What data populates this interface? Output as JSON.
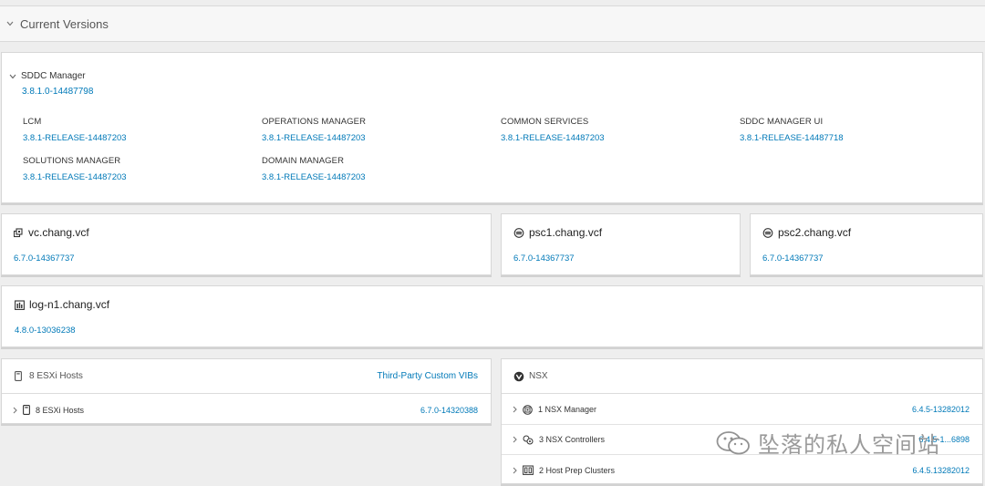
{
  "section": {
    "title": "Current Versions"
  },
  "sddc": {
    "title": "SDDC Manager",
    "version": "3.8.1.0-14487798",
    "components": [
      {
        "name": "LCM",
        "version": "3.8.1-RELEASE-14487203"
      },
      {
        "name": "OPERATIONS MANAGER",
        "version": "3.8.1-RELEASE-14487203"
      },
      {
        "name": "COMMON SERVICES",
        "version": "3.8.1-RELEASE-14487203"
      },
      {
        "name": "SDDC MANAGER UI",
        "version": "3.8.1-RELEASE-14487718"
      },
      {
        "name": "SOLUTIONS MANAGER",
        "version": "3.8.1-RELEASE-14487203"
      },
      {
        "name": "DOMAIN MANAGER",
        "version": "3.8.1-RELEASE-14487203"
      }
    ]
  },
  "vms": [
    {
      "name": "vc.chang.vcf",
      "version": "6.7.0-14367737",
      "icon": "vcenter-icon"
    },
    {
      "name": "psc1.chang.vcf",
      "version": "6.7.0-14367737",
      "icon": "psc-icon"
    },
    {
      "name": "psc2.chang.vcf",
      "version": "6.7.0-14367737",
      "icon": "psc-icon"
    },
    {
      "name": "log-n1.chang.vcf",
      "version": "4.8.0-13036238",
      "icon": "log-insight-icon"
    }
  ],
  "esxi_panel": {
    "title": "8 ESXi Hosts",
    "link": "Third-Party Custom VIBs",
    "rows": [
      {
        "label": "8 ESXi Hosts",
        "version": "6.7.0-14320388"
      }
    ]
  },
  "nsx_panel": {
    "title": "NSX",
    "rows": [
      {
        "label": "1 NSX Manager",
        "version": "6.4.5-13282012"
      },
      {
        "label": "3 NSX Controllers",
        "version": "6.4.5-1...6898"
      },
      {
        "label": "2 Host Prep Clusters",
        "version": "6.4.5.13282012"
      }
    ]
  },
  "watermark": {
    "text": "坠落的私人空间站"
  },
  "colors": {
    "link": "#0079b8",
    "background": "#eeeeee",
    "card": "#ffffff"
  }
}
